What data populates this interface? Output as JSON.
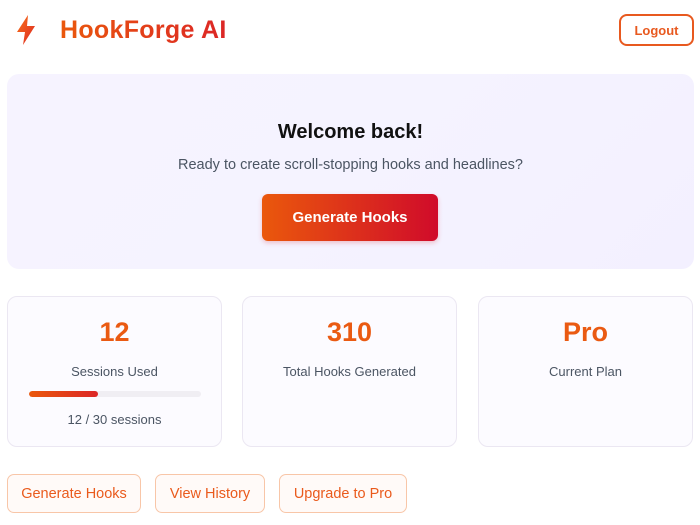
{
  "header": {
    "brand": "HookForge AI",
    "logo_icon": "lightning-bolt-icon",
    "logout_label": "Logout"
  },
  "hero": {
    "title": "Welcome back!",
    "subtitle": "Ready to create scroll-stopping hooks and headlines?",
    "cta_label": "Generate Hooks"
  },
  "stats": {
    "sessions": {
      "value": "12",
      "label": "Sessions Used",
      "progress_text": "12 / 30 sessions",
      "used": 12,
      "total": 30
    },
    "hooks": {
      "value": "310",
      "label": "Total Hooks Generated"
    },
    "plan": {
      "value": "Pro",
      "label": "Current Plan"
    }
  },
  "quick_actions": {
    "generate": "Generate Hooks",
    "history": "View History",
    "upgrade": "Upgrade to Pro"
  },
  "colors": {
    "accent": "#ea580c",
    "accent_end": "#dc2626",
    "hero_bg": "#f5f3ff"
  }
}
